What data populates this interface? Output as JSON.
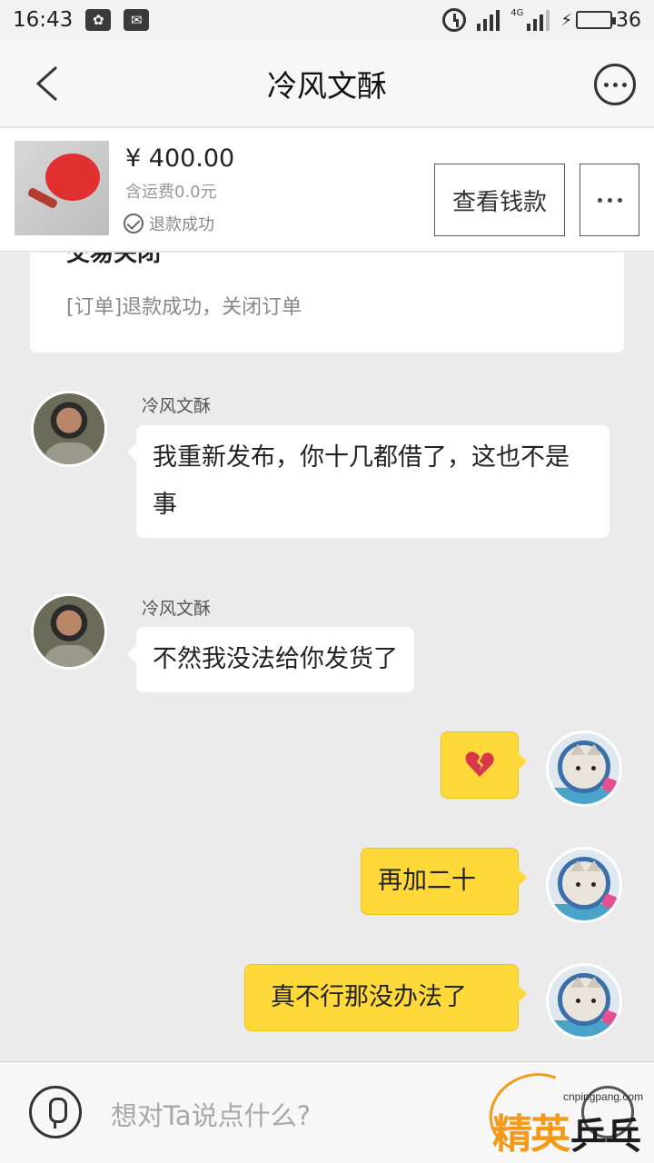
{
  "status_bar": {
    "time": "16:43",
    "battery_level": "36",
    "battery_fraction": 0.36,
    "network": "4G",
    "notification_icons": [
      "uc-browser-icon",
      "mail-icon"
    ]
  },
  "nav": {
    "title": "冷风文酥",
    "back_icon": "chevron-left-icon",
    "more_icon": "more-circle-icon"
  },
  "product": {
    "price": "¥ 400.00",
    "shipping": "含运费0.0元",
    "status": "退款成功",
    "view_money_button": "查看钱款",
    "more_icon": "ellipsis-icon"
  },
  "order_card": {
    "title": "交易关闭",
    "body": "[订单]退款成功，关闭订单"
  },
  "messages": [
    {
      "direction": "in",
      "sender": "冷风文酥",
      "text": "我重新发布，你十几都借了，这也不是事"
    },
    {
      "direction": "in",
      "sender": "冷风文酥",
      "text": "不然我没法给你发货了"
    },
    {
      "direction": "out",
      "text": "",
      "emoji": "broken-heart"
    },
    {
      "direction": "out",
      "text": "再加二十"
    },
    {
      "direction": "out",
      "text": "真不行那没办法了"
    }
  ],
  "input_bar": {
    "placeholder": "想对Ta说点什么?",
    "mic_icon": "microphone-icon",
    "emoji_icon": "emoji-icon"
  },
  "watermark": {
    "url": "cnpingpang.com",
    "text_left": "精英",
    "text_right": "乒乓网"
  },
  "colors": {
    "outgoing_bubble": "#ffd83a",
    "incoming_bubble": "#ffffff",
    "background": "#ebebeb",
    "battery_green": "#2dbe4b",
    "watermark_orange": "#f39a1b"
  }
}
